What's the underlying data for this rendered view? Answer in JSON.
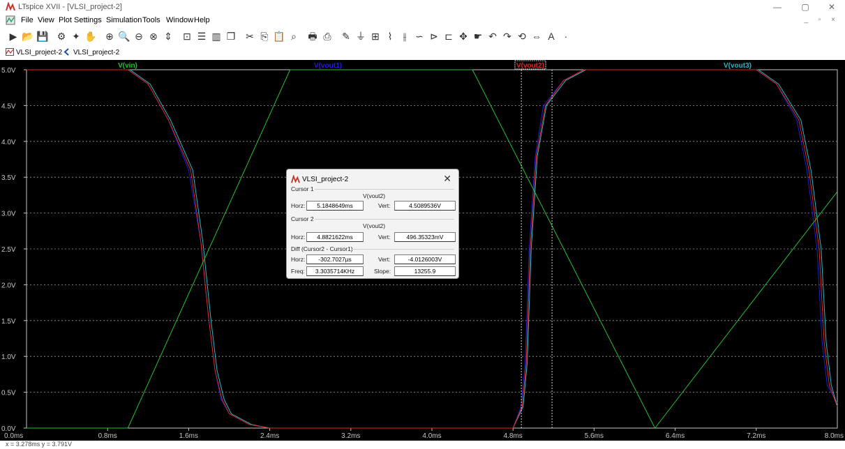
{
  "window": {
    "title": "LTspice XVII - [VLSI_project-2]",
    "min": "—",
    "max": "▢",
    "close": "✕"
  },
  "menu": [
    "File",
    "View",
    "Plot Settings",
    "Simulation",
    "Tools",
    "Window",
    "Help"
  ],
  "mdi": "_ ▫ ×",
  "toolbar_icons": [
    "run-icon",
    "open-icon",
    "save-icon",
    "settings-icon",
    "run-tool-icon",
    "pan-icon",
    "zoom-in-icon",
    "zoom-area-icon",
    "zoom-out-icon",
    "zoom-cancel-icon",
    "autorange-icon",
    "fit-icon",
    "tile-h-icon",
    "tile-v-icon",
    "cascade-icon",
    "cut-icon",
    "copy-icon",
    "paste-icon",
    "find-icon",
    "print-preview-icon",
    "print-icon",
    "draw-wire-icon",
    "ground-icon",
    "label-net-icon",
    "resistor-icon",
    "capacitor-icon",
    "inductor-icon",
    "diode-icon",
    "component-icon",
    "move-icon",
    "drag-icon",
    "undo-icon",
    "redo-icon",
    "rotate-icon",
    "mirror-icon",
    "text-icon",
    "spice-directive-icon"
  ],
  "tabs": [
    {
      "label": "VLSI_project-2"
    },
    {
      "label": "VLSI_project-2"
    }
  ],
  "colors": {
    "vin": "#22c22e",
    "vout1": "#1f1fd6",
    "vout2": "#e0281e",
    "vout3": "#2fb5c8",
    "axis": "#c8c8c8",
    "grid": "#9a9a9a"
  },
  "chart_data": {
    "type": "line",
    "xlabel": "",
    "ylabel": "",
    "xlim": [
      0,
      8.0
    ],
    "ylim": [
      0,
      5.0
    ],
    "x_ticks": [
      "0.0ms",
      "0.8ms",
      "1.6ms",
      "2.4ms",
      "3.2ms",
      "4.0ms",
      "4.8ms",
      "5.6ms",
      "6.4ms",
      "7.2ms",
      "8.0ms"
    ],
    "y_ticks": [
      "0.0V",
      "0.5V",
      "1.0V",
      "1.5V",
      "2.0V",
      "2.5V",
      "3.0V",
      "3.5V",
      "4.0V",
      "4.5V",
      "5.0V"
    ],
    "series": [
      {
        "name": "V(vin)",
        "x": [
          0,
          1.0,
          2.6,
          4.4,
          6.2,
          8.0
        ],
        "y": [
          0,
          0,
          5,
          5,
          0,
          3.3
        ]
      },
      {
        "name": "V(vout1)",
        "x": [
          0,
          0.8,
          1.0,
          1.2,
          1.4,
          1.6,
          1.72,
          1.8,
          1.86,
          1.92,
          2.0,
          2.2,
          2.4,
          4.8,
          4.88,
          4.92,
          4.96,
          5.02,
          5.1,
          5.3,
          5.5,
          7.0,
          7.2,
          7.4,
          7.6,
          7.7,
          7.8,
          7.85,
          7.9,
          8.0
        ],
        "y": [
          5,
          5,
          5,
          4.8,
          4.3,
          3.6,
          2.6,
          1.5,
          0.8,
          0.4,
          0.2,
          0.05,
          0,
          0,
          0.3,
          0.9,
          2.5,
          3.8,
          4.5,
          4.85,
          5,
          5,
          5,
          4.8,
          4.3,
          3.6,
          2.5,
          1.2,
          0.6,
          0.35
        ]
      },
      {
        "name": "V(vout2)",
        "x": [
          0,
          0.8,
          1.0,
          1.2,
          1.4,
          1.62,
          1.72,
          1.8,
          1.86,
          1.93,
          2.0,
          2.2,
          2.4,
          4.8,
          4.89,
          4.93,
          4.97,
          5.03,
          5.12,
          5.3,
          5.5,
          7.0,
          7.2,
          7.4,
          7.62,
          7.72,
          7.82,
          7.87,
          7.92,
          8.0
        ],
        "y": [
          5,
          5,
          5,
          4.8,
          4.3,
          3.6,
          2.6,
          1.5,
          0.8,
          0.4,
          0.2,
          0.05,
          0,
          0,
          0.3,
          0.9,
          2.5,
          3.8,
          4.5,
          4.85,
          5,
          5,
          5,
          4.8,
          4.3,
          3.6,
          2.5,
          1.2,
          0.6,
          0.3
        ]
      },
      {
        "name": "V(vout3)",
        "x": [
          0,
          0.8,
          1.02,
          1.22,
          1.42,
          1.64,
          1.74,
          1.82,
          1.88,
          1.95,
          2.02,
          2.22,
          2.4,
          4.8,
          4.9,
          4.94,
          4.98,
          5.04,
          5.13,
          5.32,
          5.52,
          7.0,
          7.22,
          7.42,
          7.64,
          7.74,
          7.84,
          7.89,
          7.94,
          8.0
        ],
        "y": [
          5,
          5,
          5,
          4.8,
          4.3,
          3.6,
          2.6,
          1.5,
          0.8,
          0.4,
          0.2,
          0.05,
          0,
          0,
          0.3,
          0.9,
          2.5,
          3.8,
          4.5,
          4.85,
          5,
          5,
          5,
          4.8,
          4.3,
          3.6,
          2.5,
          1.2,
          0.6,
          0.3
        ]
      }
    ],
    "cursors": [
      5.1848649,
      4.8821622
    ],
    "grid": true
  },
  "dialog": {
    "title": "VLSI_project-2",
    "cursor1_label": "Cursor 1",
    "cursor1_trace": "V(vout2)",
    "cursor2_label": "Cursor 2",
    "cursor2_trace": "V(vout2)",
    "diff_label": "Diff (Cursor2 - Cursor1)",
    "horz_label": "Horz:",
    "vert_label": "Vert:",
    "freq_label": "Freq:",
    "slope_label": "Slope:",
    "c1_horz": "5.1848649ms",
    "c1_vert": "4.5089536V",
    "c2_horz": "4.8821622ms",
    "c2_vert": "496.35323mV",
    "d_horz": "-302.7027µs",
    "d_vert": "-4.0126003V",
    "freq": "3.3035714KHz",
    "slope": "13255.9"
  },
  "status": "x = 3.278ms   y = 3.791V"
}
